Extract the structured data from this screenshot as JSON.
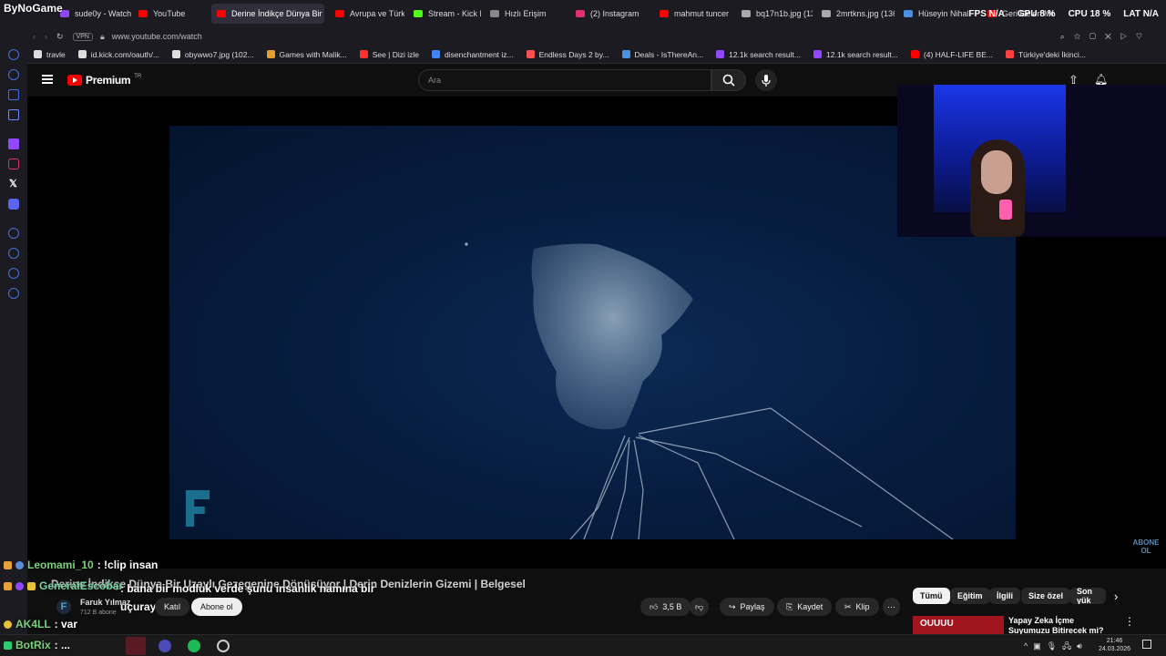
{
  "brand": "ByNoGame",
  "overlay_stats": {
    "fps_label": "FPS",
    "fps_value": "N/A",
    "gpu_label": "GPU",
    "gpu_value": "8 %",
    "cpu_label": "CPU",
    "cpu_value": "18 %",
    "lat_label": "LAT",
    "lat_value": "N/A"
  },
  "tabs": [
    {
      "label": "sude0y - Watch",
      "color": "#9147ff"
    },
    {
      "label": "YouTube",
      "color": "#ff0000"
    },
    {
      "label": "Derine İndikçe Dünya Bir",
      "color": "#ff0000",
      "active": true
    },
    {
      "label": "Avrupa ve Türkiye",
      "color": "#ff0000"
    },
    {
      "label": "Stream - Kick D",
      "color": "#53fc18"
    },
    {
      "label": "Hızlı Erişim",
      "color": "#888888"
    },
    {
      "label": "(2) Instagram",
      "color": "#e1306c"
    },
    {
      "label": "mahmut tuncer",
      "color": "#ff0000"
    },
    {
      "label": "bq17n1b.jpg (1366",
      "color": "#aaaaaa"
    },
    {
      "label": "2mrtkns.jpg (1366",
      "color": "#aaaaaa"
    },
    {
      "label": "Hüseyin Nihal",
      "color": "#4a90e2"
    },
    {
      "label": "Geri Gelen Moş",
      "color": "#ff0000"
    }
  ],
  "url": "www.youtube.com/watch",
  "vpn_label": "VPN",
  "bookmarks": [
    {
      "label": "travle",
      "color": "#dddddd"
    },
    {
      "label": "id.kick.com/oauth/...",
      "color": "#dddddd"
    },
    {
      "label": "obywwo7.jpg (102...",
      "color": "#dddddd"
    },
    {
      "label": "Games with Malik...",
      "color": "#e0a030"
    },
    {
      "label": "See | Dizi izle",
      "color": "#ff3030"
    },
    {
      "label": "disenchantment iz...",
      "color": "#4285f4"
    },
    {
      "label": "Endless Days 2 by...",
      "color": "#ff5050"
    },
    {
      "label": "Deals - IsThereAn...",
      "color": "#4a90e2"
    },
    {
      "label": "12.1k search result...",
      "color": "#9147ff"
    },
    {
      "label": "12.1k search result...",
      "color": "#9147ff"
    },
    {
      "label": "(4) HALF-LIFE BE...",
      "color": "#ff0000"
    },
    {
      "label": "Türkiye'deki İkinci...",
      "color": "#ff4040"
    }
  ],
  "yt": {
    "logo_label": "Premium",
    "logo_region": "TR",
    "search_placeholder": "Ara"
  },
  "watermark_corner": "ABONE OL",
  "chat": [
    {
      "user": "Leomami_10",
      "text": ": !clip insan",
      "user_color": "#7ad37a"
    },
    {
      "user": "GeneralEscobar",
      "text": ": bana bir modluk verde şunu insanlık namına bir uçurayım",
      "user_color": "#7ad3a0"
    },
    {
      "user": "AK4LL",
      "text": ": var",
      "user_color": "#7ad37a"
    },
    {
      "user": "BotRix",
      "text": ": ...",
      "user_color": "#7ad37a"
    }
  ],
  "video": {
    "title": "Derine İndikçe Dünya Bir Uzaylı Gezegenine Dönüşüyor | Derin Denizlerin Gizemi | Belgesel",
    "channel": "Faruk Yılmaz",
    "subs": "712 B abone",
    "join_label": "Katıl",
    "subscribe_label": "Abone ol",
    "likes": "3,5 B",
    "share_label": "Paylaş",
    "save_label": "Kaydet",
    "clip_label": "Klip"
  },
  "chips": [
    "Tümü",
    "Eğitim",
    "İlgili",
    "Size özel",
    "Son yük"
  ],
  "rec": {
    "title": "Yapay Zeka İçme Suyumuzu Bitirecek mi?",
    "thumb_text": "ОUUUU"
  },
  "clock": {
    "time": "21:46",
    "date": "24.03.2026"
  }
}
